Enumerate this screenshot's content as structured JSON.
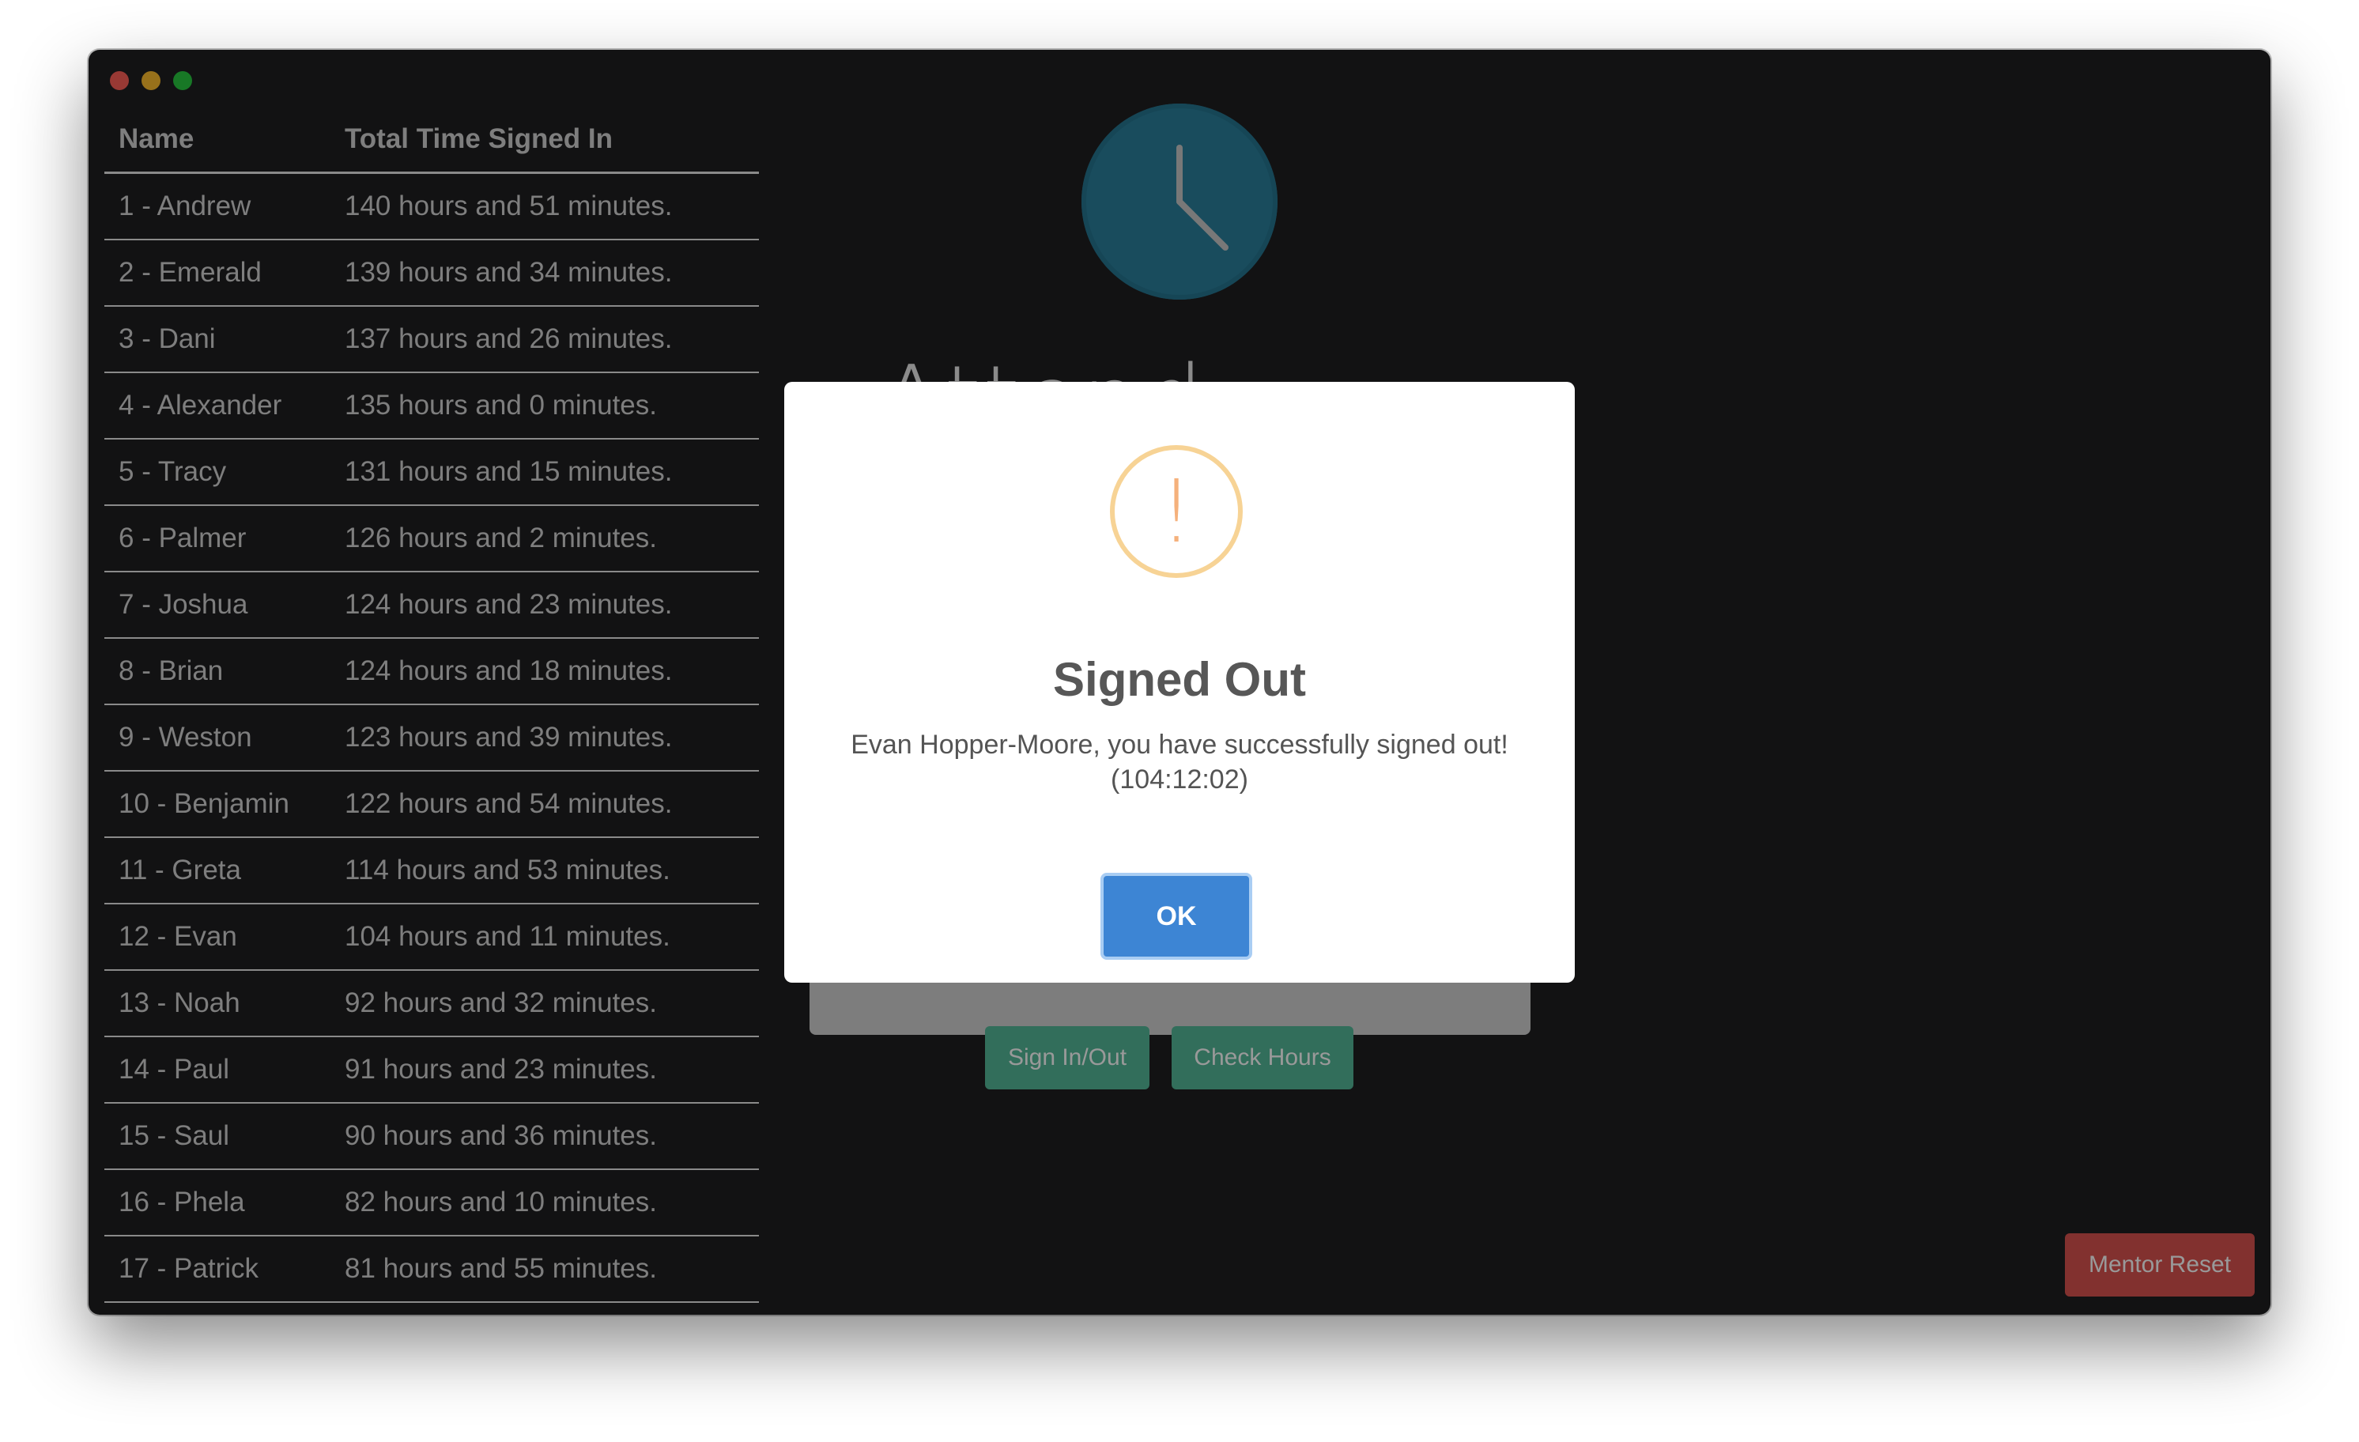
{
  "window": {
    "title": ""
  },
  "leaderboard": {
    "headers": {
      "name": "Name",
      "time": "Total Time Signed In"
    },
    "rows": [
      {
        "name": "1 - Andrew",
        "time": "140 hours and 51 minutes."
      },
      {
        "name": "2 - Emerald",
        "time": "139 hours and 34 minutes."
      },
      {
        "name": "3 - Dani",
        "time": "137 hours and 26 minutes."
      },
      {
        "name": "4 - Alexander",
        "time": "135 hours and 0 minutes."
      },
      {
        "name": "5 - Tracy",
        "time": "131 hours and 15 minutes."
      },
      {
        "name": "6 - Palmer",
        "time": "126 hours and 2 minutes."
      },
      {
        "name": "7 - Joshua",
        "time": "124 hours and 23 minutes."
      },
      {
        "name": "8 - Brian",
        "time": "124 hours and 18 minutes."
      },
      {
        "name": "9 - Weston",
        "time": "123 hours and 39 minutes."
      },
      {
        "name": "10 - Benjamin",
        "time": "122 hours and 54 minutes."
      },
      {
        "name": "11 - Greta",
        "time": "114 hours and 53 minutes."
      },
      {
        "name": "12 - Evan",
        "time": "104 hours and 11 minutes."
      },
      {
        "name": "13 - Noah",
        "time": "92 hours and 32 minutes."
      },
      {
        "name": "14 - Paul",
        "time": "91 hours and 23 minutes."
      },
      {
        "name": "15 - Saul",
        "time": "90 hours and 36 minutes."
      },
      {
        "name": "16 - Phela",
        "time": "82 hours and 10 minutes."
      },
      {
        "name": "17 - Patrick",
        "time": "81 hours and 55 minutes."
      }
    ]
  },
  "main": {
    "title_partial": "Attend",
    "buttons": {
      "sign_in_out": "Sign In/Out",
      "check_hours": "Check Hours",
      "mentor_reset": "Mentor Reset"
    }
  },
  "modal": {
    "icon": "warning-icon",
    "icon_glyph": "!",
    "title": "Signed Out",
    "message_line1": "Evan Hopper-Moore, you have successfully signed out!",
    "message_line2": "(104:12:02)",
    "ok_label": "OK"
  },
  "colors": {
    "app_background": "#1f1f21",
    "primary_button": "#54b898",
    "danger_button": "#d9534f",
    "clock": "#2a7f9b",
    "ok_button": "#3d85d4",
    "warning": "#f7d395"
  }
}
